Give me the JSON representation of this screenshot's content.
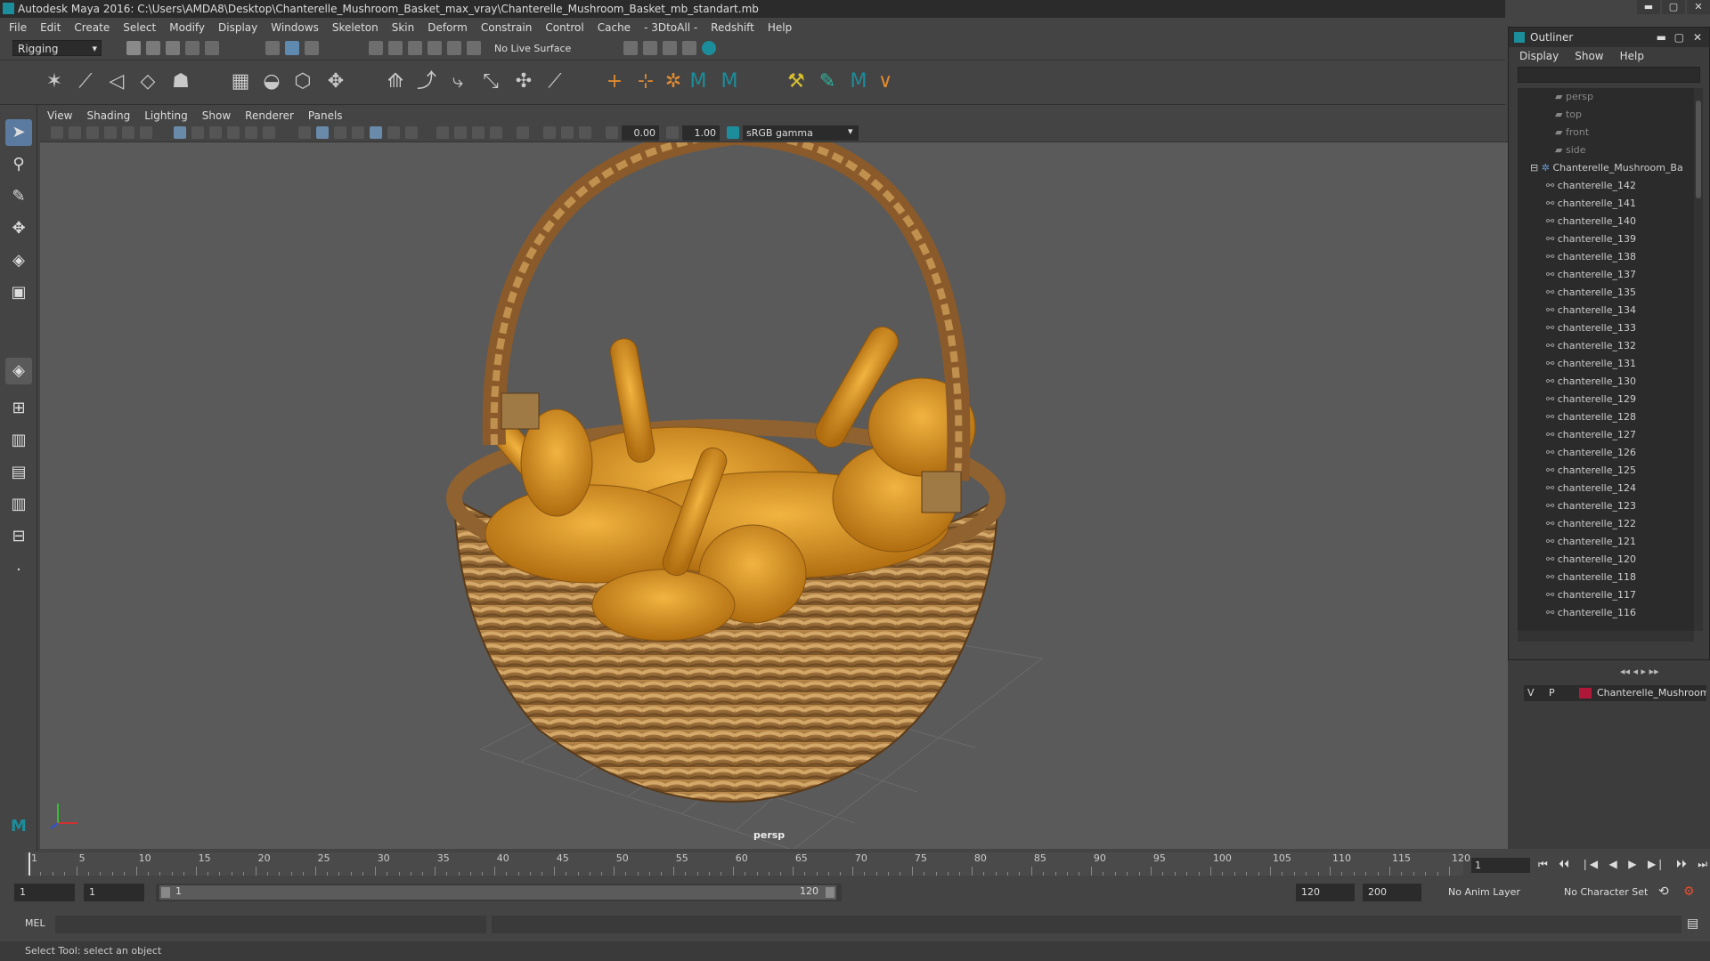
{
  "window": {
    "title": "Autodesk Maya 2016: C:\\Users\\AMDA8\\Desktop\\Chanterelle_Mushroom_Basket_max_vray\\Chanterelle_Mushroom_Basket_mb_standart.mb",
    "btn_min": "▬",
    "btn_max": "▢",
    "btn_close": "✕"
  },
  "menubar": [
    "File",
    "Edit",
    "Create",
    "Select",
    "Modify",
    "Display",
    "Windows",
    "Skeleton",
    "Skin",
    "Deform",
    "Constrain",
    "Control",
    "Cache",
    "- 3DtoAll -",
    "Redshift",
    "Help"
  ],
  "toolbar": {
    "mode": "Rigging",
    "live_surface": "No Live Surface"
  },
  "viewport": {
    "menu": [
      "View",
      "Shading",
      "Lighting",
      "Show",
      "Renderer",
      "Panels"
    ],
    "exposure": "0.00",
    "gamma": "1.00",
    "colorspace": "sRGB gamma",
    "camera_label": "persp"
  },
  "outliner": {
    "title": "Outliner",
    "menu": [
      "Display",
      "Show",
      "Help"
    ],
    "cameras": [
      "persp",
      "top",
      "front",
      "side"
    ],
    "group": "Chanterelle_Mushroom_Ba",
    "items": [
      "chanterelle_142",
      "chanterelle_141",
      "chanterelle_140",
      "chanterelle_139",
      "chanterelle_138",
      "chanterelle_137",
      "chanterelle_135",
      "chanterelle_134",
      "chanterelle_133",
      "chanterelle_132",
      "chanterelle_131",
      "chanterelle_130",
      "chanterelle_129",
      "chanterelle_128",
      "chanterelle_127",
      "chanterelle_126",
      "chanterelle_125",
      "chanterelle_124",
      "chanterelle_123",
      "chanterelle_122",
      "chanterelle_121",
      "chanterelle_120",
      "chanterelle_118",
      "chanterelle_117",
      "chanterelle_116"
    ]
  },
  "layers": {
    "v": "V",
    "p": "P",
    "name": "Chanterelle_Mushroom",
    "color": "#b0183a"
  },
  "timeline": {
    "ticks": [
      "1",
      "5",
      "10",
      "15",
      "20",
      "25",
      "30",
      "35",
      "40",
      "45",
      "50",
      "55",
      "60",
      "65",
      "70",
      "75",
      "80",
      "85",
      "90",
      "95",
      "100",
      "105",
      "110",
      "115",
      "120"
    ],
    "current_frame": "1",
    "play": {
      "first": "⏮",
      "prev_key": "⏴⏴",
      "prev": "❘◀",
      "back": "◀",
      "fwd": "▶",
      "next": "▶❘",
      "next_key": "⏵⏵",
      "last": "⏭"
    }
  },
  "range": {
    "start": "1",
    "start2": "1",
    "slider_start": "1",
    "slider_end": "120",
    "end": "120",
    "end2": "200",
    "anim_layer": "No Anim Layer",
    "char_set": "No Character Set"
  },
  "cmd": {
    "lang": "MEL"
  },
  "status": {
    "text": "Select Tool: select an object"
  },
  "colors": {
    "mushroom": "#d99a2b",
    "basket": "#a8783c",
    "accent": "#1c8d9b"
  }
}
